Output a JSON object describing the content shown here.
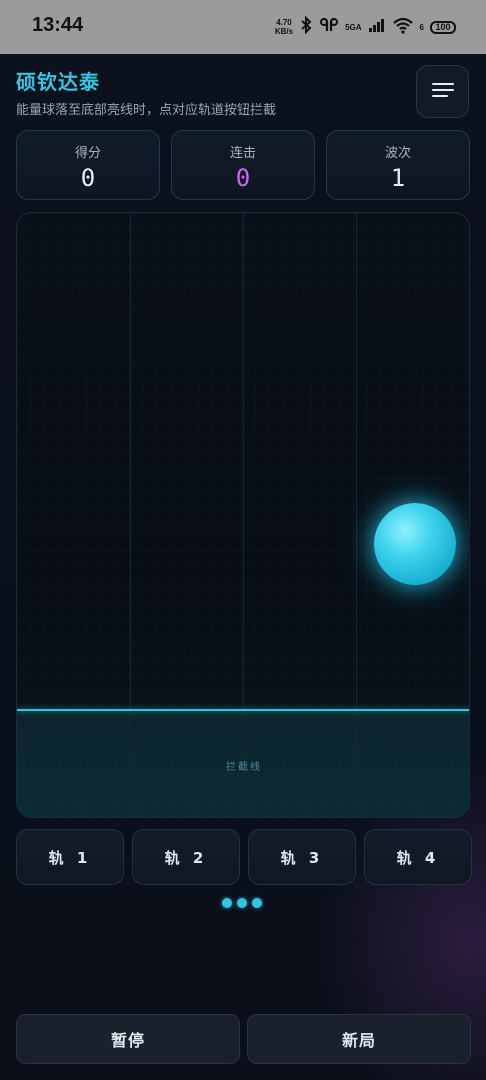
{
  "status_bar": {
    "time": "13:44",
    "net_speed_value": "4.70",
    "net_speed_unit": "KB/s",
    "network_type": "5GA",
    "wifi_sub": "6",
    "battery": "100"
  },
  "header": {
    "title": "硕钦达泰",
    "subtitle": "能量球落至底部亮线时，点对应轨道按钮拦截"
  },
  "stats": {
    "score": {
      "label": "得分",
      "value": "0"
    },
    "combo": {
      "label": "连击",
      "value": "0"
    },
    "wave": {
      "label": "波次",
      "value": "1"
    }
  },
  "board": {
    "intercept_label": "拦截线",
    "lane_count": 4,
    "orb": {
      "lane": 4,
      "fall_progress": 0.5
    }
  },
  "lanes": [
    {
      "label": "轨 1"
    },
    {
      "label": "轨 2"
    },
    {
      "label": "轨 3"
    },
    {
      "label": "轨 4"
    }
  ],
  "controls": {
    "pause_label": "暂停",
    "new_game_label": "新局"
  },
  "colors": {
    "accent": "#36c6e3",
    "combo": "#c76af0",
    "background": "#0a0f1a"
  }
}
